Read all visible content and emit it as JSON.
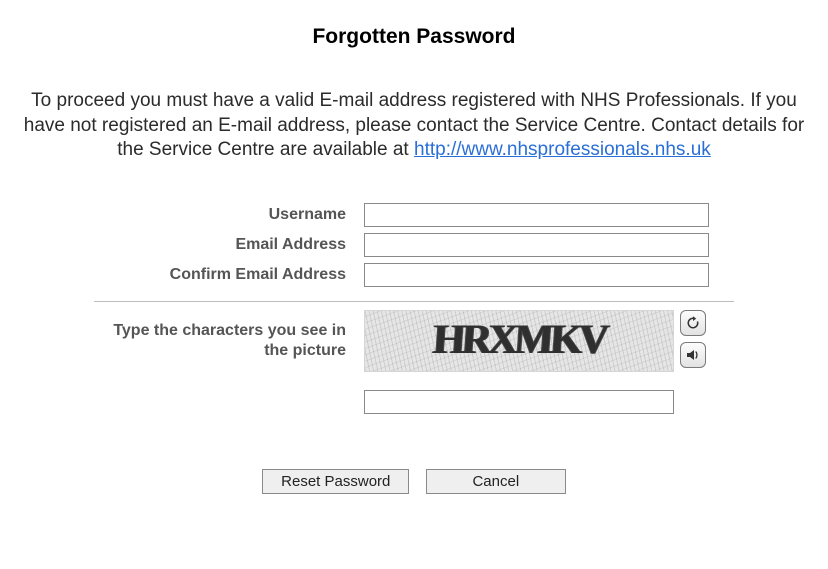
{
  "title": "Forgotten Password",
  "instructions_text": "To proceed you must have a valid E-mail address registered with NHS Professionals. If you have not registered an E-mail address, please contact the Service Centre. Contact details for the Service Centre are available at ",
  "instructions_link_text": "http://www.nhsprofessionals.nhs.uk",
  "fields": {
    "username_label": "Username",
    "username_value": "",
    "email_label": "Email Address",
    "email_value": "",
    "confirm_email_label": "Confirm Email Address",
    "confirm_email_value": ""
  },
  "captcha": {
    "label": "Type the characters you see in the picture",
    "image_text": "HRXMKV",
    "input_value": ""
  },
  "buttons": {
    "reset": "Reset Password",
    "cancel": "Cancel"
  }
}
